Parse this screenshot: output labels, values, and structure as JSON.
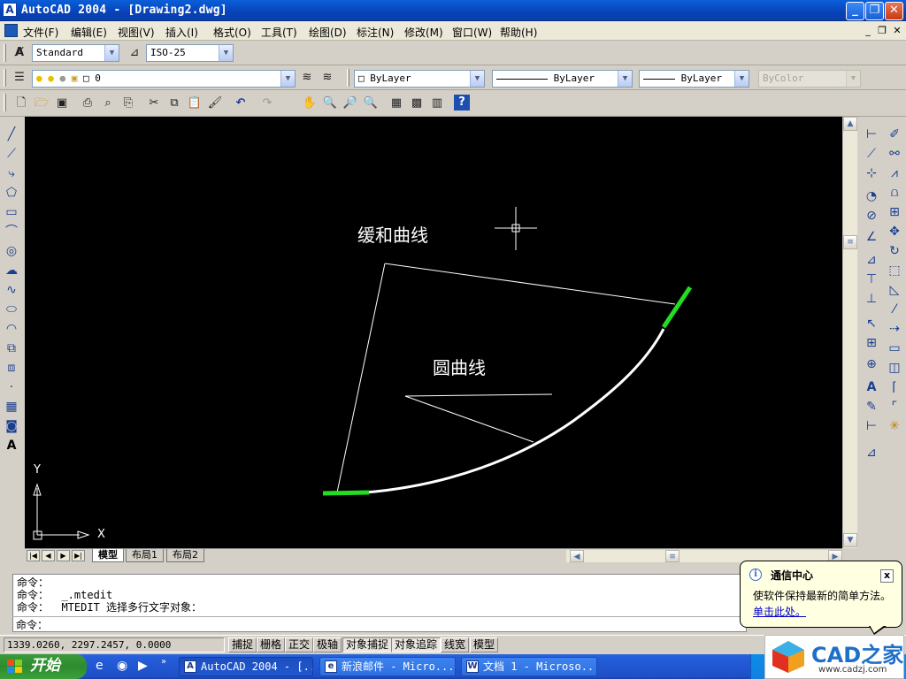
{
  "window": {
    "app_icon": "A",
    "title": "AutoCAD 2004 - [Drawing2.dwg]",
    "buttons": {
      "minimize": "_",
      "maximize": "❐",
      "close": "✕"
    }
  },
  "menubar": {
    "items": [
      "文件(F)",
      "编辑(E)",
      "视图(V)",
      "插入(I)",
      "格式(O)",
      "工具(T)",
      "绘图(D)",
      "标注(N)",
      "修改(M)",
      "窗口(W)",
      "帮助(H)"
    ],
    "mdi": {
      "minimize": "_",
      "restore": "❐",
      "close": "✕"
    }
  },
  "styles_toolbar": {
    "text_style": "Standard",
    "dim_style": "ISO-25"
  },
  "layers_toolbar": {
    "current_layer": "0",
    "color": "ByLayer",
    "linetype": "ByLayer",
    "lineweight": "ByLayer",
    "plot_style": "ByColor"
  },
  "drawing": {
    "label_easement": "缓和曲线",
    "label_circular": "圆曲线",
    "ucs_y": "Y",
    "ucs_x": "X",
    "colors": {
      "background": "#000000",
      "lines": "#ffffff",
      "highlight": "#22dd22"
    }
  },
  "layout_tabs": {
    "nav": [
      "|◀",
      "◀",
      "▶",
      "▶|"
    ],
    "tabs": [
      "模型",
      "布局1",
      "布局2"
    ],
    "active": "模型"
  },
  "command": {
    "lines": [
      "命令：",
      "命令：  _.mtedit",
      "命令：  MTEDIT 选择多行文字对象："
    ],
    "prompt": "命令："
  },
  "statusbar": {
    "coords": "1339.0260,   2297.2457, 0.0000",
    "toggles": [
      "捕捉",
      "栅格",
      "正交",
      "极轴",
      "对象捕捉",
      "对象追踪",
      "线宽",
      "模型"
    ]
  },
  "balloon": {
    "title": "通信中心",
    "message": "使软件保持最新的简单方法。",
    "link": "单击此处。",
    "close": "x"
  },
  "taskbar": {
    "start": "开始",
    "tasks": [
      {
        "label": "AutoCAD 2004 - [...",
        "icon": "A"
      },
      {
        "label": "新浪邮件 - Micro...",
        "icon": "e"
      },
      {
        "label": "文档 1 - Microso...",
        "icon": "W"
      }
    ]
  },
  "watermark": {
    "brand": "CAD之家",
    "url": "www.cadzj.com"
  }
}
